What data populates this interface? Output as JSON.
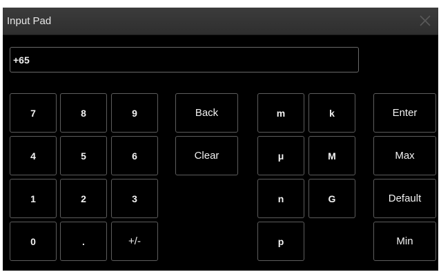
{
  "window": {
    "title": "Input Pad",
    "close_icon": "close-icon"
  },
  "input": {
    "value": "+65"
  },
  "digits": {
    "k7": "7",
    "k8": "8",
    "k9": "9",
    "k4": "4",
    "k5": "5",
    "k6": "6",
    "k1": "1",
    "k2": "2",
    "k3": "3",
    "k0": "0",
    "dot": ".",
    "sign": "+/-"
  },
  "edit": {
    "back": "Back",
    "clear": "Clear"
  },
  "units": {
    "m": "m",
    "k": "k",
    "u": "μ",
    "M": "M",
    "n": "n",
    "G": "G",
    "p": "p"
  },
  "actions": {
    "enter": "Enter",
    "max": "Max",
    "default": "Default",
    "min": "Min"
  },
  "colors": {
    "background": "#000000",
    "key_border": "#5e5e5e",
    "titlebar": "#353535",
    "text": "#f2f2f2"
  }
}
